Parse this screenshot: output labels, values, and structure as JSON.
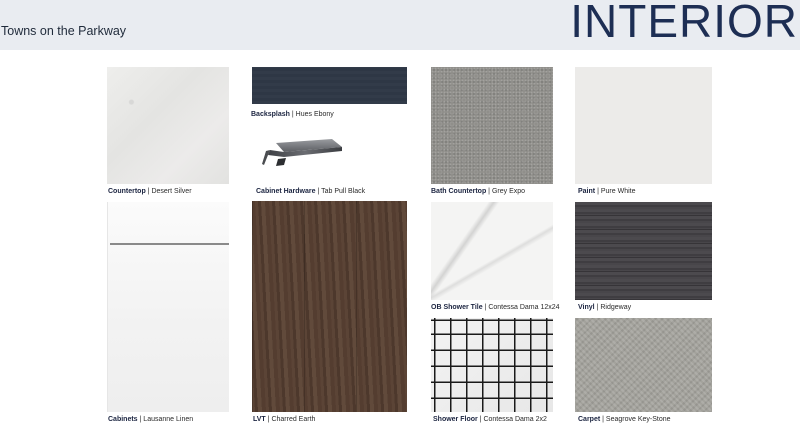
{
  "header": {
    "subtitle": "Towns on the Parkway",
    "title": "INTERIOR"
  },
  "swatches": [
    {
      "name": "Countertop",
      "value": "Desert Silver"
    },
    {
      "name": "Backsplash",
      "value": "Hues Ebony"
    },
    {
      "name": "Cabinet Hardware",
      "value": "Tab Pull Black"
    },
    {
      "name": "Bath Countertop",
      "value": "Grey Expo"
    },
    {
      "name": "Paint",
      "value": "Pure White"
    },
    {
      "name": "Cabinets",
      "value": "Lausanne Linen"
    },
    {
      "name": "LVT",
      "value": "Charred Earth"
    },
    {
      "name": "OB Shower Tile",
      "value": "Contessa Dama 12x24"
    },
    {
      "name": "Vinyl",
      "value": "Ridgeway"
    },
    {
      "name": "Shower Floor",
      "value": "Contessa Dama 2x2"
    },
    {
      "name": "Carpet",
      "value": "Seagrove Key-Stone"
    }
  ],
  "separator": "|"
}
